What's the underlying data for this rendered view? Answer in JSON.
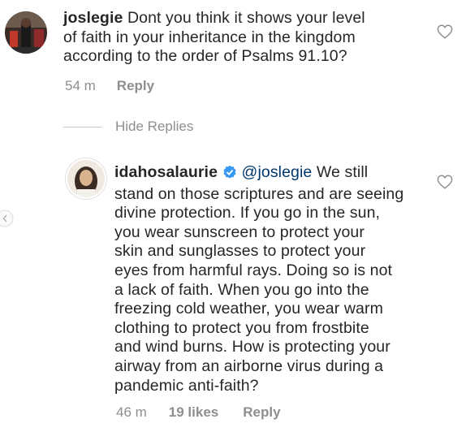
{
  "comments": [
    {
      "username": "joslegie",
      "lines": [
        "Dont you think it shows your level",
        "of faith in your inheritance in the kingdom",
        "according to the order of Psalms 91.10?"
      ],
      "time": "54 m",
      "reply_label": "Reply"
    },
    {
      "username": "idahosalaurie",
      "verified": true,
      "mention": "@joslegie",
      "first_line_rest": "We still",
      "lines": [
        "stand on those scriptures and are seeing",
        "divine protection.  If you go in the sun,",
        "you wear sunscreen to protect your",
        "skin  and sunglasses to protect your",
        "eyes from harmful rays. Doing so is not",
        "a lack of faith. When you go into the",
        "freezing cold weather, you wear warm",
        "clothing to protect you from frostbite",
        "and wind burns. How is protecting your",
        "airway from an airborne virus during a",
        "pandemic anti-faith?"
      ],
      "time": "46 m",
      "likes": "19 likes",
      "reply_label": "Reply"
    }
  ],
  "hide_replies_label": "Hide Replies",
  "icons": {
    "like": "heart-outline-icon",
    "verified": "verified-badge-icon",
    "nav": "chevron-left-icon"
  },
  "colors": {
    "text": "#262626",
    "secondary": "#8e8e8e",
    "mention": "#00376b",
    "verified": "#3897f0"
  }
}
